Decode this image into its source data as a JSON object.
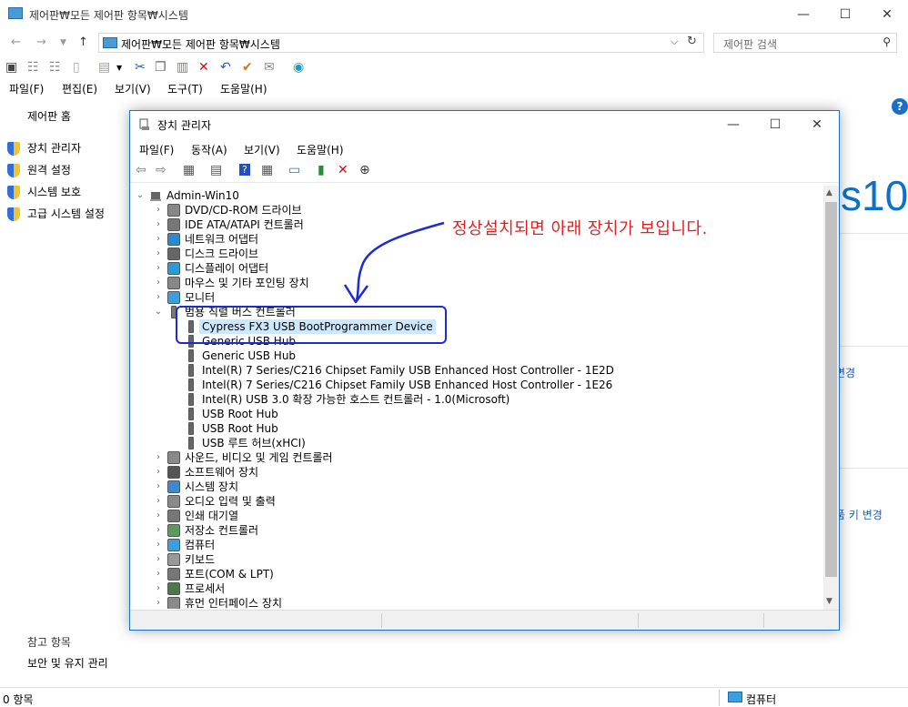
{
  "control_panel": {
    "window_title": "제어판₩모든 제어판 항목₩시스템",
    "address": "제어판₩모든 제어판 항목₩시스템",
    "search_placeholder": "제어판 검색",
    "menu": [
      "파일(F)",
      "편집(E)",
      "보기(V)",
      "도구(T)",
      "도움말(H)"
    ],
    "sidebar": {
      "home": "제어판 홈",
      "links": [
        "장치 관리자",
        "원격 설정",
        "시스템 보호",
        "고급 시스템 설정"
      ]
    },
    "footer": {
      "heading": "참고 항목",
      "link": "보안 및 유지 관리"
    },
    "right": {
      "brand_fragment": "s10",
      "link1": "변경",
      "link2": "품 키 변경"
    },
    "status": {
      "count": "0 항목",
      "location": "컴퓨터"
    }
  },
  "device_manager": {
    "title": "장치 관리자",
    "menu": [
      "파일(F)",
      "동작(A)",
      "보기(V)",
      "도움말(H)"
    ],
    "root": "Admin-Win10",
    "categories_before": [
      "DVD/CD-ROM 드라이브",
      "IDE ATA/ATAPI 컨트롤러",
      "네트워크 어댑터",
      "디스크 드라이브",
      "디스플레이 어댑터",
      "마우스 및 기타 포인팅 장치",
      "모니터"
    ],
    "expanded_category": "범용 직렬 버스 컨트롤러",
    "usb_devices": [
      "Cypress FX3 USB BootProgrammer Device",
      "Generic USB Hub",
      "Generic USB Hub",
      "Intel(R) 7 Series/C216 Chipset Family USB Enhanced Host Controller - 1E2D",
      "Intel(R) 7 Series/C216 Chipset Family USB Enhanced Host Controller - 1E26",
      "Intel(R) USB 3.0 확장 가능한 호스트 컨트롤러 - 1.0(Microsoft)",
      "USB Root Hub",
      "USB Root Hub",
      "USB 루트 허브(xHCI)"
    ],
    "categories_after": [
      "사운드, 비디오 및 게임 컨트롤러",
      "소프트웨어 장치",
      "시스템 장치",
      "오디오 입력 및 출력",
      "인쇄 대기열",
      "저장소 컨트롤러",
      "컴퓨터",
      "키보드",
      "포트(COM & LPT)",
      "프로세서",
      "휴먼 인터페이스 장치"
    ]
  },
  "annotation": {
    "note": "정상설치되면 아래 장치가 보입니다.",
    "color": "#e02020",
    "box_color": "#1c2bd4"
  }
}
